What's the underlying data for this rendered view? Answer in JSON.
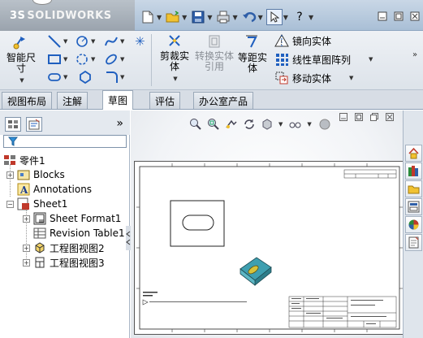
{
  "app": {
    "brand": "SOLIDWORKS",
    "brand_prefix": "3S"
  },
  "quick_access": {
    "items": [
      "new-icon",
      "open-icon",
      "save-icon",
      "print-icon",
      "undo-icon",
      "select-icon",
      "help-icon"
    ]
  },
  "window_controls": [
    "minimize-icon",
    "restore-icon",
    "close-icon"
  ],
  "ribbon": {
    "smart_dimension": "智能尺寸",
    "trim_entities": "剪裁实体",
    "convert_entities": "转换实体引用",
    "offset_entities": "等距实体",
    "mirror_entities": "镜向实体",
    "linear_pattern": "线性草图阵列",
    "move_entities": "移动实体",
    "disabled_color": "#8a8f96"
  },
  "tabs": {
    "items": [
      {
        "label": "视图布局",
        "active": false
      },
      {
        "label": "注解",
        "active": false
      },
      {
        "label": "草图",
        "active": true
      },
      {
        "label": "评估",
        "active": false
      },
      {
        "label": "办公室产品",
        "active": false
      }
    ],
    "more": "»"
  },
  "feature_tree": {
    "nodes": [
      {
        "label": "零件1",
        "icon": "part-icon"
      },
      {
        "label": "Blocks",
        "icon": "blocks-icon"
      },
      {
        "label": "Annotations",
        "icon": "annotations-icon"
      },
      {
        "label": "Sheet1",
        "icon": "sheet-icon"
      },
      {
        "label": "Sheet Format1",
        "icon": "sheet-format-icon"
      },
      {
        "label": "Revision Table1",
        "icon": "revision-table-icon"
      },
      {
        "label": "工程图视图2",
        "icon": "drawing-view-icon"
      },
      {
        "label": "工程图视图3",
        "icon": "drawing-view-icon"
      }
    ]
  },
  "colors": {
    "accent": "#1f5fbf",
    "model_teal": "#3e9fb0",
    "model_yellow": "#d7c33a"
  }
}
